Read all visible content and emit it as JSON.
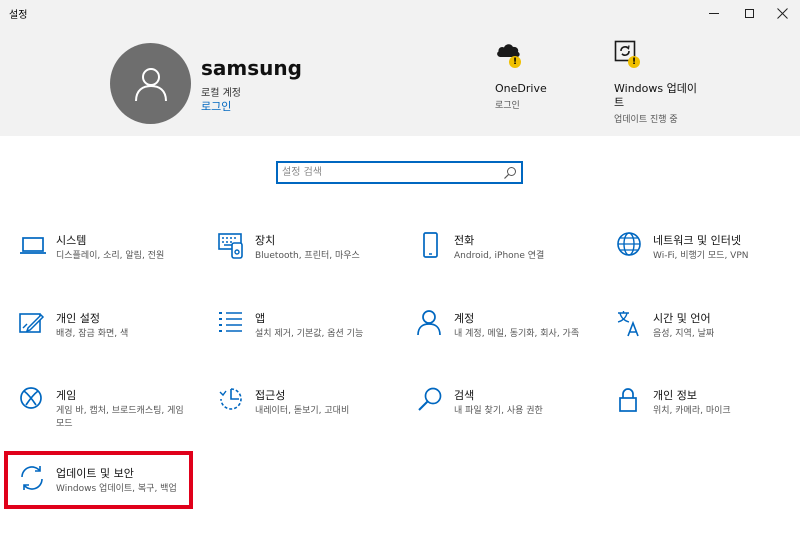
{
  "window": {
    "title": "설정",
    "controls": [
      "minimize",
      "maximize",
      "close"
    ]
  },
  "account": {
    "name": "samsung",
    "type": "로컬 계정",
    "signin_link": "로그인"
  },
  "header_items": [
    {
      "label": "OneDrive",
      "sub": "로그인",
      "icon": "onedrive-icon",
      "warning": "!"
    },
    {
      "label": "Windows 업데이트",
      "sub": "업데이트 진행 중",
      "icon": "windows-update-icon",
      "warning": "!"
    }
  ],
  "search": {
    "placeholder": "설정 검색",
    "value": ""
  },
  "categories": [
    {
      "name": "시스템",
      "desc": "디스플레이, 소리, 알림, 전원",
      "icon": "laptop-icon"
    },
    {
      "name": "장치",
      "desc": "Bluetooth, 프린터, 마우스",
      "icon": "keyboard-icon"
    },
    {
      "name": "전화",
      "desc": "Android, iPhone 연결",
      "icon": "phone-icon"
    },
    {
      "name": "네트워크 및 인터넷",
      "desc": "Wi-Fi, 비행기 모드, VPN",
      "icon": "globe-icon"
    },
    {
      "name": "개인 설정",
      "desc": "배경, 잠금 화면, 색",
      "icon": "personalization-icon"
    },
    {
      "name": "앱",
      "desc": "설치 제거, 기본값, 옵션 기능",
      "icon": "apps-list-icon"
    },
    {
      "name": "계정",
      "desc": "내 계정, 메일, 동기화, 회사, 가족",
      "icon": "person-icon"
    },
    {
      "name": "시간 및 언어",
      "desc": "음성, 지역, 날짜",
      "icon": "time-language-icon"
    },
    {
      "name": "게임",
      "desc": "게임 바, 캡처, 브로드캐스팅, 게임 모드",
      "icon": "xbox-icon"
    },
    {
      "name": "접근성",
      "desc": "내레이터, 돋보기, 고대비",
      "icon": "ease-of-access-icon"
    },
    {
      "name": "검색",
      "desc": "내 파일 찾기, 사용 권한",
      "icon": "magnifier-icon"
    },
    {
      "name": "개인 정보",
      "desc": "위치, 카메라, 마이크",
      "icon": "lock-icon"
    },
    {
      "name": "업데이트 및 보안",
      "desc": "Windows 업데이트, 복구, 백업",
      "icon": "sync-icon"
    }
  ],
  "colors": {
    "accent": "#0067c0",
    "highlight": "#e0001a",
    "header_bg": "#f2f2f2",
    "warning": "#f0c000"
  }
}
